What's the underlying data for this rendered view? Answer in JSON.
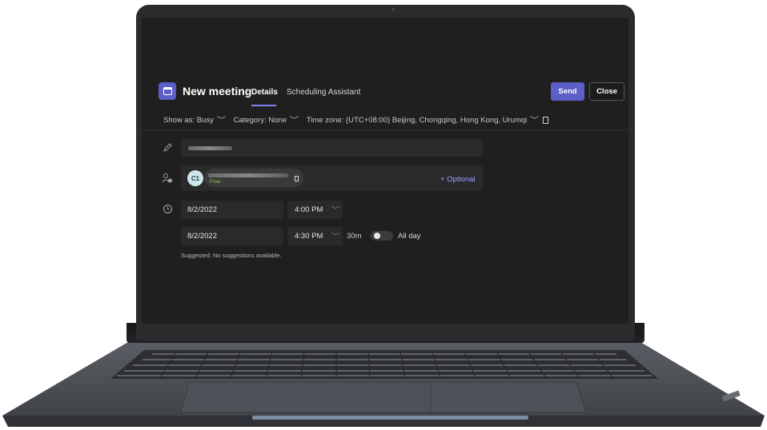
{
  "meeting": {
    "title": "New meeting",
    "tabs": [
      {
        "label": "Details",
        "active": true
      },
      {
        "label": "Scheduling Assistant",
        "active": false
      }
    ],
    "actions": {
      "send_label": "Send",
      "close_label": "Close"
    },
    "options": {
      "show_as": "Show as: Busy",
      "category": "Category: None",
      "timezone": "Time zone: (UTC+08:00) Beijing, Chongqing, Hong Kong, Urumqi"
    },
    "attendee": {
      "initials": "C1",
      "status": "Free"
    },
    "optional_label": "+ Optional",
    "start": {
      "date": "8/2/2022",
      "time": "4:00 PM"
    },
    "end": {
      "date": "8/2/2022",
      "time": "4:30 PM"
    },
    "duration": "30m",
    "all_day_label": "All day",
    "all_day_on": false,
    "suggestion_text": "Suggested: No suggestions available."
  },
  "icons": {
    "pencil": "pencil-icon",
    "people": "people-add-icon",
    "clock": "clock-icon",
    "calendar": "calendar-icon",
    "chevron": "chevron-down-icon"
  },
  "colors": {
    "accent": "#5b5fc7",
    "link": "#9ea2ff",
    "free_status": "#92c353",
    "background": "#1f1f1f"
  }
}
